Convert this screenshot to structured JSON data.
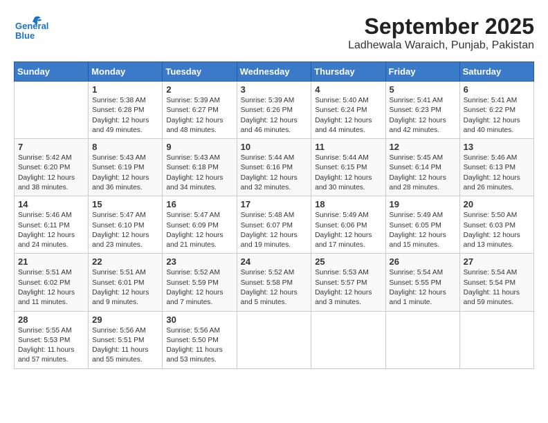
{
  "header": {
    "title": "September 2025",
    "subtitle": "Ladhewala Waraich, Punjab, Pakistan",
    "logo_line1": "General",
    "logo_line2": "Blue"
  },
  "days_of_week": [
    "Sunday",
    "Monday",
    "Tuesday",
    "Wednesday",
    "Thursday",
    "Friday",
    "Saturday"
  ],
  "weeks": [
    [
      {
        "day": "",
        "info": ""
      },
      {
        "day": "1",
        "info": "Sunrise: 5:38 AM\nSunset: 6:28 PM\nDaylight: 12 hours\nand 49 minutes."
      },
      {
        "day": "2",
        "info": "Sunrise: 5:39 AM\nSunset: 6:27 PM\nDaylight: 12 hours\nand 48 minutes."
      },
      {
        "day": "3",
        "info": "Sunrise: 5:39 AM\nSunset: 6:26 PM\nDaylight: 12 hours\nand 46 minutes."
      },
      {
        "day": "4",
        "info": "Sunrise: 5:40 AM\nSunset: 6:24 PM\nDaylight: 12 hours\nand 44 minutes."
      },
      {
        "day": "5",
        "info": "Sunrise: 5:41 AM\nSunset: 6:23 PM\nDaylight: 12 hours\nand 42 minutes."
      },
      {
        "day": "6",
        "info": "Sunrise: 5:41 AM\nSunset: 6:22 PM\nDaylight: 12 hours\nand 40 minutes."
      }
    ],
    [
      {
        "day": "7",
        "info": "Sunrise: 5:42 AM\nSunset: 6:20 PM\nDaylight: 12 hours\nand 38 minutes."
      },
      {
        "day": "8",
        "info": "Sunrise: 5:43 AM\nSunset: 6:19 PM\nDaylight: 12 hours\nand 36 minutes."
      },
      {
        "day": "9",
        "info": "Sunrise: 5:43 AM\nSunset: 6:18 PM\nDaylight: 12 hours\nand 34 minutes."
      },
      {
        "day": "10",
        "info": "Sunrise: 5:44 AM\nSunset: 6:16 PM\nDaylight: 12 hours\nand 32 minutes."
      },
      {
        "day": "11",
        "info": "Sunrise: 5:44 AM\nSunset: 6:15 PM\nDaylight: 12 hours\nand 30 minutes."
      },
      {
        "day": "12",
        "info": "Sunrise: 5:45 AM\nSunset: 6:14 PM\nDaylight: 12 hours\nand 28 minutes."
      },
      {
        "day": "13",
        "info": "Sunrise: 5:46 AM\nSunset: 6:13 PM\nDaylight: 12 hours\nand 26 minutes."
      }
    ],
    [
      {
        "day": "14",
        "info": "Sunrise: 5:46 AM\nSunset: 6:11 PM\nDaylight: 12 hours\nand 24 minutes."
      },
      {
        "day": "15",
        "info": "Sunrise: 5:47 AM\nSunset: 6:10 PM\nDaylight: 12 hours\nand 23 minutes."
      },
      {
        "day": "16",
        "info": "Sunrise: 5:47 AM\nSunset: 6:09 PM\nDaylight: 12 hours\nand 21 minutes."
      },
      {
        "day": "17",
        "info": "Sunrise: 5:48 AM\nSunset: 6:07 PM\nDaylight: 12 hours\nand 19 minutes."
      },
      {
        "day": "18",
        "info": "Sunrise: 5:49 AM\nSunset: 6:06 PM\nDaylight: 12 hours\nand 17 minutes."
      },
      {
        "day": "19",
        "info": "Sunrise: 5:49 AM\nSunset: 6:05 PM\nDaylight: 12 hours\nand 15 minutes."
      },
      {
        "day": "20",
        "info": "Sunrise: 5:50 AM\nSunset: 6:03 PM\nDaylight: 12 hours\nand 13 minutes."
      }
    ],
    [
      {
        "day": "21",
        "info": "Sunrise: 5:51 AM\nSunset: 6:02 PM\nDaylight: 12 hours\nand 11 minutes."
      },
      {
        "day": "22",
        "info": "Sunrise: 5:51 AM\nSunset: 6:01 PM\nDaylight: 12 hours\nand 9 minutes."
      },
      {
        "day": "23",
        "info": "Sunrise: 5:52 AM\nSunset: 5:59 PM\nDaylight: 12 hours\nand 7 minutes."
      },
      {
        "day": "24",
        "info": "Sunrise: 5:52 AM\nSunset: 5:58 PM\nDaylight: 12 hours\nand 5 minutes."
      },
      {
        "day": "25",
        "info": "Sunrise: 5:53 AM\nSunset: 5:57 PM\nDaylight: 12 hours\nand 3 minutes."
      },
      {
        "day": "26",
        "info": "Sunrise: 5:54 AM\nSunset: 5:55 PM\nDaylight: 12 hours\nand 1 minute."
      },
      {
        "day": "27",
        "info": "Sunrise: 5:54 AM\nSunset: 5:54 PM\nDaylight: 11 hours\nand 59 minutes."
      }
    ],
    [
      {
        "day": "28",
        "info": "Sunrise: 5:55 AM\nSunset: 5:53 PM\nDaylight: 11 hours\nand 57 minutes."
      },
      {
        "day": "29",
        "info": "Sunrise: 5:56 AM\nSunset: 5:51 PM\nDaylight: 11 hours\nand 55 minutes."
      },
      {
        "day": "30",
        "info": "Sunrise: 5:56 AM\nSunset: 5:50 PM\nDaylight: 11 hours\nand 53 minutes."
      },
      {
        "day": "",
        "info": ""
      },
      {
        "day": "",
        "info": ""
      },
      {
        "day": "",
        "info": ""
      },
      {
        "day": "",
        "info": ""
      }
    ]
  ]
}
